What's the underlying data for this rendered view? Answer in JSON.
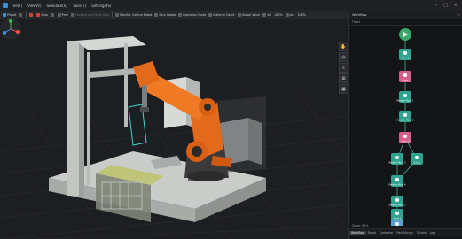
{
  "menubar": {
    "items": [
      "File(F)",
      "View(V)",
      "Simulate(S)",
      "Tools(T)",
      "Settings(S)"
    ],
    "window_controls": [
      "–",
      "□",
      "✕"
    ]
  },
  "toolbar": {
    "items": [
      {
        "label": "Preset",
        "icon": "preset-icon",
        "color": "blue"
      },
      {
        "label": "",
        "icon": "menu-icon",
        "color": "gray"
      },
      {
        "label": "",
        "icon": "record-icon",
        "color": "red"
      },
      {
        "label": "Stop",
        "icon": "stop-icon",
        "color": "red"
      },
      {
        "label": "",
        "icon": "play-icon",
        "color": "gray"
      },
      {
        "label": "Prev",
        "icon": "prev-icon",
        "color": "gray"
      },
      {
        "label": "Forward and Tools Step",
        "icon": "step-icon",
        "color": "dim"
      },
      {
        "label": "Monitor Control Robot",
        "icon": "monitor-icon",
        "color": "gray"
      },
      {
        "label": "Sync Robot",
        "icon": "sync-icon",
        "color": "gray"
      },
      {
        "label": "Operation Mode",
        "icon": "mode-icon",
        "color": "gray"
      },
      {
        "label": "Material Count",
        "icon": "count-icon",
        "color": "gray"
      },
      {
        "label": "Global Value",
        "icon": "global-icon",
        "color": "gray"
      },
      {
        "label": "Vel",
        "icon": "velocity-icon",
        "color": "gray"
      },
      {
        "label": "100%",
        "icon": "",
        "color": "gray"
      },
      {
        "label": "Acc",
        "icon": "acceleration-icon",
        "color": "gray"
      },
      {
        "label": "100%",
        "icon": "",
        "color": "gray"
      }
    ]
  },
  "viewport": {
    "tools": [
      "✋",
      "◎",
      "⌕",
      "⊞",
      "▣"
    ],
    "help": "?"
  },
  "panel": {
    "title": "Workflow",
    "close": "✕",
    "subtitle": "Flow1",
    "zoom": "Zoom: 95%",
    "tabs": [
      "Workflow",
      "Robot",
      "Container",
      "Part Library",
      "Others",
      "Log"
    ],
    "active_tab": 0
  },
  "flow": {
    "nodes": [
      {
        "label": "",
        "kind": "start",
        "color": "#3aa86a"
      },
      {
        "label": "Move 1",
        "kind": "move",
        "color": "#2fa38f"
      },
      {
        "label": "Vision",
        "kind": "vision",
        "color": "#d65e8a"
      },
      {
        "label": "Relative Move 1",
        "kind": "move",
        "color": "#2fa38f"
      },
      {
        "label": "Relative Move 2",
        "kind": "move",
        "color": "#2fa38f"
      },
      {
        "label": "Vision 2",
        "kind": "vision",
        "color": "#d65e8a"
      },
      {
        "label": "Relative Move 3",
        "kind": "move",
        "color": "#2fa38f"
      },
      {
        "label": "Relative Move 4",
        "kind": "move",
        "color": "#2fa38f"
      },
      {
        "label": "Count",
        "kind": "count",
        "color": "#2fa38f"
      },
      {
        "label": "Relative Move 5",
        "kind": "move",
        "color": "#2fa38f"
      },
      {
        "label": "Move 2",
        "kind": "move",
        "color": "#2fa38f"
      },
      {
        "label": "End",
        "kind": "end",
        "color": "#5aa0c8"
      }
    ]
  }
}
